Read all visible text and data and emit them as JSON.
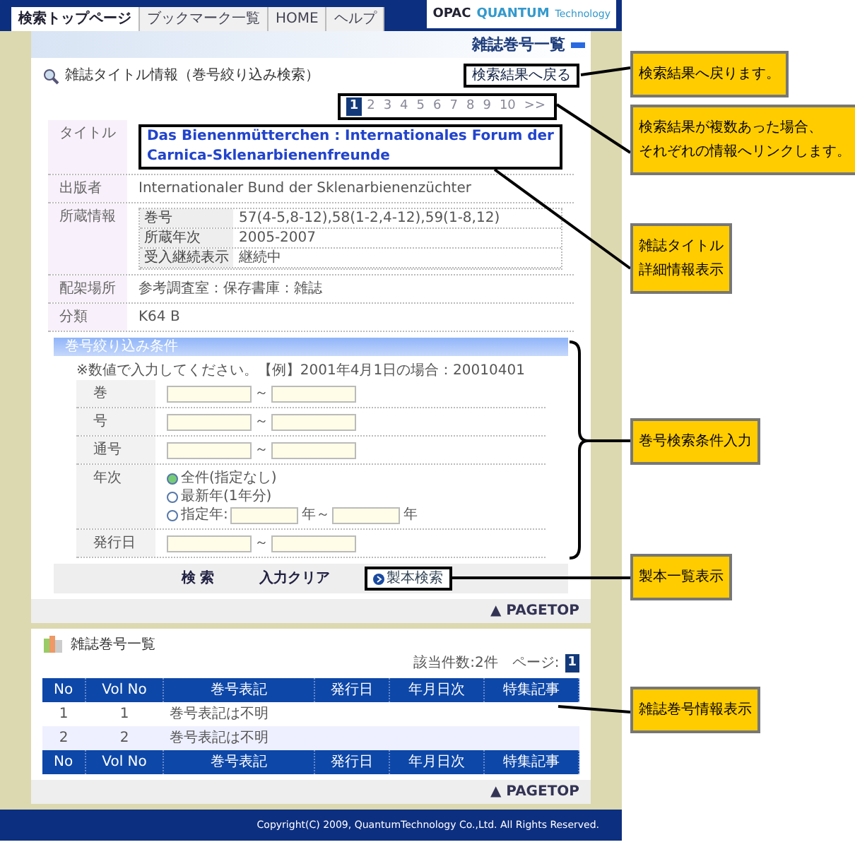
{
  "nav": {
    "tabs": [
      {
        "label": "検索トップページ",
        "selected": true
      },
      {
        "label": "ブックマーク一覧",
        "selected": false
      },
      {
        "label": "HOME",
        "selected": false
      },
      {
        "label": "ヘルプ",
        "selected": false
      }
    ],
    "logo": {
      "opac": "OPAC",
      "brand": "QUANTUM",
      "suffix": "Technology"
    }
  },
  "page_title": "雑誌巻号一覧",
  "detail": {
    "title": "雑誌タイトル情報（巻号絞り込み検索）",
    "back_button": "検索結果へ戻る",
    "pagination": [
      {
        "label": "1",
        "selected": true
      },
      {
        "label": "2",
        "selected": false
      },
      {
        "label": "3",
        "selected": false
      },
      {
        "label": "4",
        "selected": false
      },
      {
        "label": "5",
        "selected": false
      },
      {
        "label": "6",
        "selected": false
      },
      {
        "label": "7",
        "selected": false
      },
      {
        "label": "8",
        "selected": false
      },
      {
        "label": "9",
        "selected": false
      },
      {
        "label": "10",
        "selected": false
      },
      {
        "label": ">>",
        "selected": false
      }
    ],
    "rows": [
      {
        "label": "タイトル",
        "kind": "link",
        "value": "Das Bienenmütterchen : Internationales Forum der Carnica-Sklenarbienenfreunde"
      },
      {
        "label": "出版者",
        "kind": "text",
        "value": "Internationaler Bund der Sklenarbienenzüchter"
      },
      {
        "label": "所蔵情報",
        "kind": "holdings",
        "items": [
          {
            "label": "巻号",
            "value": "57(4-5,8-12),58(1-2,4-12),59(1-8,12)"
          },
          {
            "label": "所蔵年次",
            "value": "2005-2007"
          },
          {
            "label": "受入継続表示",
            "value": "継続中"
          }
        ]
      },
      {
        "label": "配架場所",
        "kind": "text",
        "value": "参考調査室：保存書庫：雑誌"
      },
      {
        "label": "分類",
        "kind": "text",
        "value": "K64 B"
      }
    ]
  },
  "filter": {
    "title": "巻号絞り込み条件",
    "note": "※数値で入力してください。【例】2001年4月1日の場合：20010401",
    "fields": [
      {
        "label": "巻",
        "kind": "range",
        "separator": "～"
      },
      {
        "label": "号",
        "kind": "range",
        "separator": "～"
      },
      {
        "label": "通号",
        "kind": "range",
        "separator": "～"
      },
      {
        "label": "年次",
        "kind": "year",
        "options": [
          {
            "label": "全件(指定なし)",
            "selected": true
          },
          {
            "label": "最新年(1年分)",
            "selected": false
          },
          {
            "label": "指定年:",
            "selected": false
          }
        ],
        "from_unit": "年～",
        "to_unit": "年"
      },
      {
        "label": "発行日",
        "kind": "range",
        "separator": "～"
      }
    ],
    "buttons": [
      {
        "label": "検 索",
        "kind": "plain"
      },
      {
        "label": "入力クリア",
        "kind": "plain"
      },
      {
        "label": "製本検索",
        "kind": "icon"
      }
    ]
  },
  "pagetop_1": "▲ PAGETOP",
  "volumes": {
    "title": "雑誌巻号一覧",
    "count": "該当件数:2件　ページ:",
    "pages": [
      {
        "label": "1",
        "selected": true
      }
    ],
    "columns": [
      "No",
      "Vol No",
      "巻号表記",
      "発行日",
      "年月日次",
      "特集記事"
    ],
    "rows": [
      [
        "1",
        "1",
        "巻号表記は不明",
        "",
        "",
        ""
      ],
      [
        "2",
        "2",
        "巻号表記は不明",
        "",
        "",
        ""
      ]
    ],
    "footer_columns": [
      "No",
      "Vol No",
      "巻号表記",
      "発行日",
      "年月日次",
      "特集記事"
    ]
  },
  "pagetop_2": "▲ PAGETOP",
  "footer": "Copyright(C) 2009, QuantumTechnology Co.,Ltd. All Rights Reserved.",
  "callouts": [
    {
      "lines": [
        "検索結果へ戻ります。"
      ]
    },
    {
      "lines": [
        "検索結果が複数あった場合、",
        "それぞれの情報へリンクします。"
      ]
    },
    {
      "lines": [
        "雑誌タイトル",
        "詳細情報表示"
      ]
    },
    {
      "lines": [
        "巻号検索条件入力"
      ]
    },
    {
      "lines": [
        "製本一覧表示"
      ]
    },
    {
      "lines": [
        "雑誌巻号情報表示"
      ]
    }
  ]
}
